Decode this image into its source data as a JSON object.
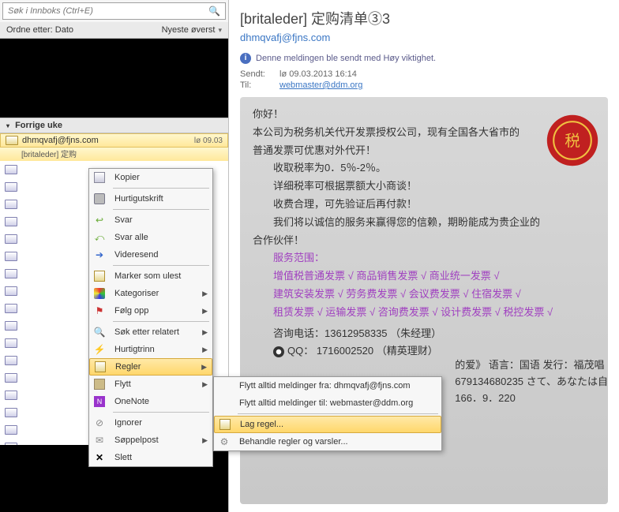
{
  "search": {
    "placeholder": "Søk i Innboks (Ctrl+E)"
  },
  "sort": {
    "label": "Ordne etter: Dato",
    "order": "Nyeste øverst"
  },
  "group": {
    "label": "Forrige uke"
  },
  "selected_msg": {
    "from": "dhmqvafj@fjns.com",
    "date": "lø 09.03",
    "subject": "[britaleder]  定购"
  },
  "mail": {
    "subject": "[britaleder]  定购清单③3",
    "from": "dhmqvafj@fjns.com",
    "importance": "Denne meldingen ble sendt med Høy viktighet.",
    "sent_label": "Sendt:",
    "sent_value": "lø 09.03.2013 16:14",
    "to_label": "Til:",
    "to_value": "webmaster@ddm.org",
    "body": {
      "greeting": "你好！",
      "l1": "本公司为税务机关代开发票授权公司，现有全国各大省市的",
      "l2": "普通发票可优惠对外代开！",
      "rate": "收取税率为0．5％-2％。",
      "l3": "详细税率可根据票额大小商谈！",
      "l4": "收费合理，可先验证后再付款！",
      "l5": "我们将以诚信的服务来赢得您的信赖，期盼能成为贵企业的",
      "l6": "合作伙伴！",
      "scope_label": "服务范围：",
      "b1": "增值税普通发票 √ 商品销售发票 √ 商业统一发票 √",
      "b2": "建筑安装发票 √ 劳务费发票 √ 会议费发票 √ 住宿发票 √",
      "b3": "租赁发票 √ 运输发票 √ 咨询费发票 √ 设计费发票 √ 税控发票 √",
      "phone": "咨询电话：13612958335 （朱经理）",
      "qq": "QQ： 1716002520  （精英理财）",
      "tail1": "的爱》 语言：国语 发行：福茂唱",
      "tail2": "679134680235 さて、あなたは自",
      "tail3": "166．9．220"
    }
  },
  "ctx1": {
    "copy": "Kopier",
    "print": "Hurtigutskrift",
    "reply": "Svar",
    "replyall": "Svar alle",
    "forward": "Videresend",
    "unread": "Marker som ulest",
    "categorize": "Kategoriser",
    "followup": "Følg opp",
    "findrel": "Søk etter relatert",
    "quick": "Hurtigtrinn",
    "rules": "Regler",
    "move": "Flytt",
    "onenote": "OneNote",
    "ignore": "Ignorer",
    "junk": "Søppelpost",
    "delete": "Slett"
  },
  "ctx2": {
    "always_from": "Flytt alltid meldinger fra: dhmqvafj@fjns.com",
    "always_to": "Flytt alltid meldinger til: webmaster@ddm.org",
    "create_rule": "Lag regel...",
    "manage": "Behandle regler og varsler..."
  }
}
